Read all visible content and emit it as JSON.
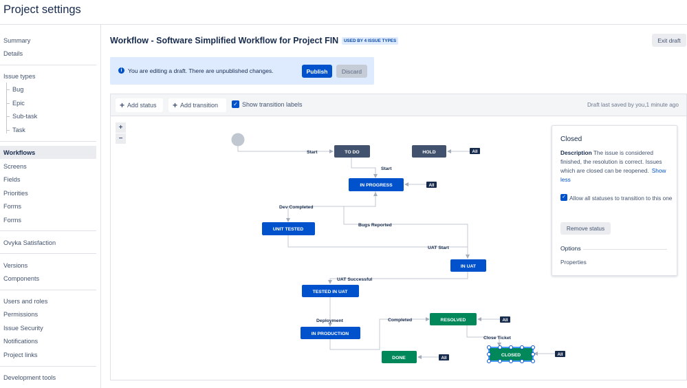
{
  "page_title": "Project settings",
  "sidebar": {
    "items": [
      {
        "label": "Summary"
      },
      {
        "label": "Details"
      },
      {
        "label": "Issue types"
      },
      {
        "label": "Bug"
      },
      {
        "label": "Epic"
      },
      {
        "label": "Sub-task"
      },
      {
        "label": "Task"
      },
      {
        "label": "Workflows"
      },
      {
        "label": "Screens"
      },
      {
        "label": "Fields"
      },
      {
        "label": "Priorities"
      },
      {
        "label": "Forms"
      },
      {
        "label": "Forms"
      },
      {
        "label": "Ovyka Satisfaction"
      },
      {
        "label": "Versions"
      },
      {
        "label": "Components"
      },
      {
        "label": "Users and roles"
      },
      {
        "label": "Permissions"
      },
      {
        "label": "Issue Security"
      },
      {
        "label": "Notifications"
      },
      {
        "label": "Project links"
      },
      {
        "label": "Development tools"
      }
    ],
    "active": "Workflows"
  },
  "header": {
    "title": "Workflow - Software Simplified Workflow for Project FIN",
    "badge": "USED BY 4 ISSUE TYPES",
    "exit_label": "Exit draft"
  },
  "banner": {
    "info_glyph": "i",
    "text": "You are editing a draft. There are unpublished changes.",
    "publish": "Publish",
    "discard": "Discard"
  },
  "toolbar": {
    "add_status": "Add status",
    "add_transition": "Add transition",
    "show_labels": "Show transition labels",
    "show_labels_checked": true,
    "saved": "Draft last saved by you,1 minute ago"
  },
  "zoom": {
    "in": "+",
    "out": "−"
  },
  "diagram": {
    "statuses": {
      "todo": "TO DO",
      "hold": "HOLD",
      "in_progress": "IN PROGRESS",
      "unit_tested": "UNIT TESTED",
      "in_uat": "IN UAT",
      "tested_in_uat": "TESTED IN UAT",
      "in_production": "IN PRODUCTION",
      "resolved": "RESOLVED",
      "done": "DONE",
      "closed": "CLOSED"
    },
    "transitions": {
      "start1": "Start",
      "start2": "Start",
      "dev_completed": "Dev Completed",
      "bugs_reported": "Bugs Reported",
      "uat_start": "UAT Start",
      "uat_successful": "UAT Successful",
      "deployment": "Deployment",
      "completed": "Completed",
      "close_ticket": "Close Ticket"
    },
    "all_label": "All",
    "colors": {
      "todo": "#42526E",
      "inprogress": "#0052CC",
      "done": "#00875A"
    }
  },
  "panel": {
    "title": "Closed",
    "desc_label": "Description",
    "desc_text": "The issue is considered finished, the resolution is correct. Issues which are closed can be reopened.",
    "show_less": "Show less",
    "allow_text": "Allow all statuses to transition to this one",
    "allow_checked": true,
    "remove_status": "Remove status",
    "options": "Options",
    "properties": "Properties"
  }
}
